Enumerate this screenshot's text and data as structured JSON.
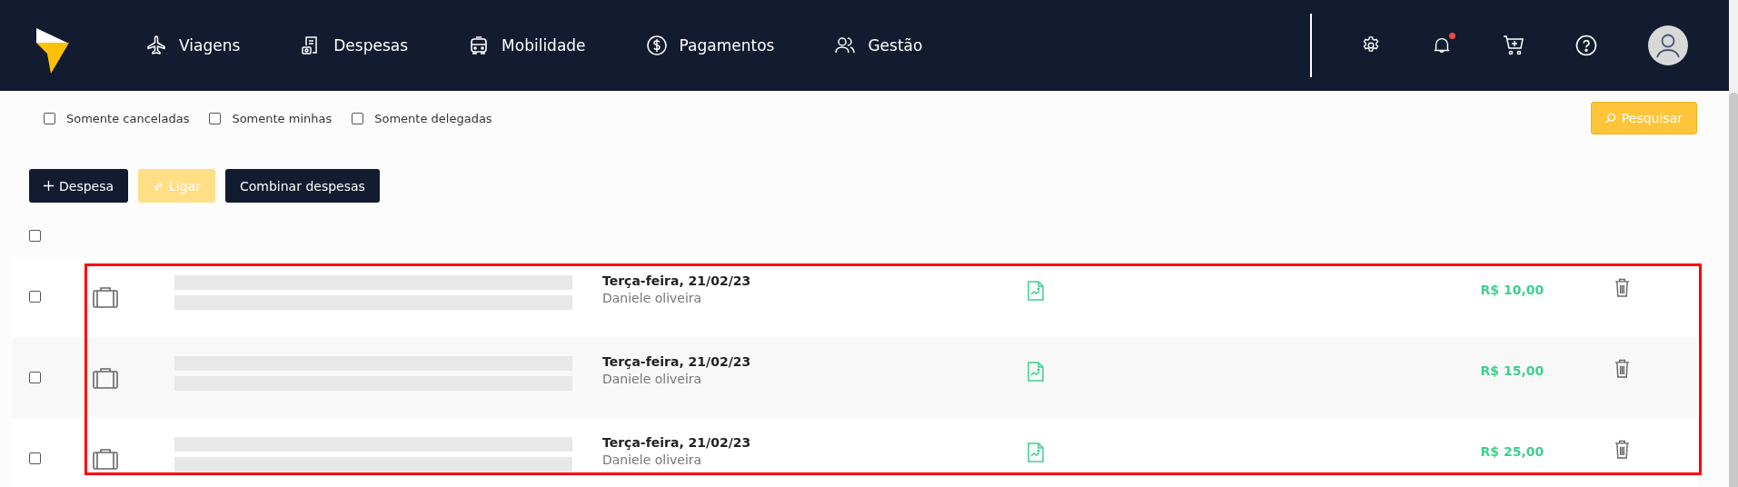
{
  "nav": {
    "items": [
      {
        "label": "Viagens",
        "kind": "plane"
      },
      {
        "label": "Despesas",
        "kind": "receipt"
      },
      {
        "label": "Mobilidade",
        "kind": "car"
      },
      {
        "label": "Pagamentos",
        "kind": "dollar"
      },
      {
        "label": "Gestão",
        "kind": "people"
      }
    ],
    "has_notification": true
  },
  "filters": [
    {
      "label": "Somente canceladas",
      "checked": false
    },
    {
      "label": "Somente minhas",
      "checked": false
    },
    {
      "label": "Somente delegadas",
      "checked": false
    }
  ],
  "search_button": "Pesquisar",
  "actions": [
    {
      "label": "Despesa",
      "kind": "add",
      "disabled": false
    },
    {
      "label": "Ligar",
      "kind": "link",
      "disabled": true
    },
    {
      "label": "Combinar despesas",
      "kind": "plain",
      "disabled": false
    }
  ],
  "select_all": {
    "checked": false
  },
  "rows": [
    {
      "checked": false,
      "date": "Terça-feira, 21/02/23",
      "person": "Daniele oliveira",
      "amount": "R$ 10,00"
    },
    {
      "checked": false,
      "date": "Terça-feira, 21/02/23",
      "person": "Daniele oliveira",
      "amount": "R$ 15,00"
    },
    {
      "checked": false,
      "date": "Terça-feira, 21/02/23",
      "person": "Daniele oliveira",
      "amount": "R$ 25,00"
    }
  ]
}
